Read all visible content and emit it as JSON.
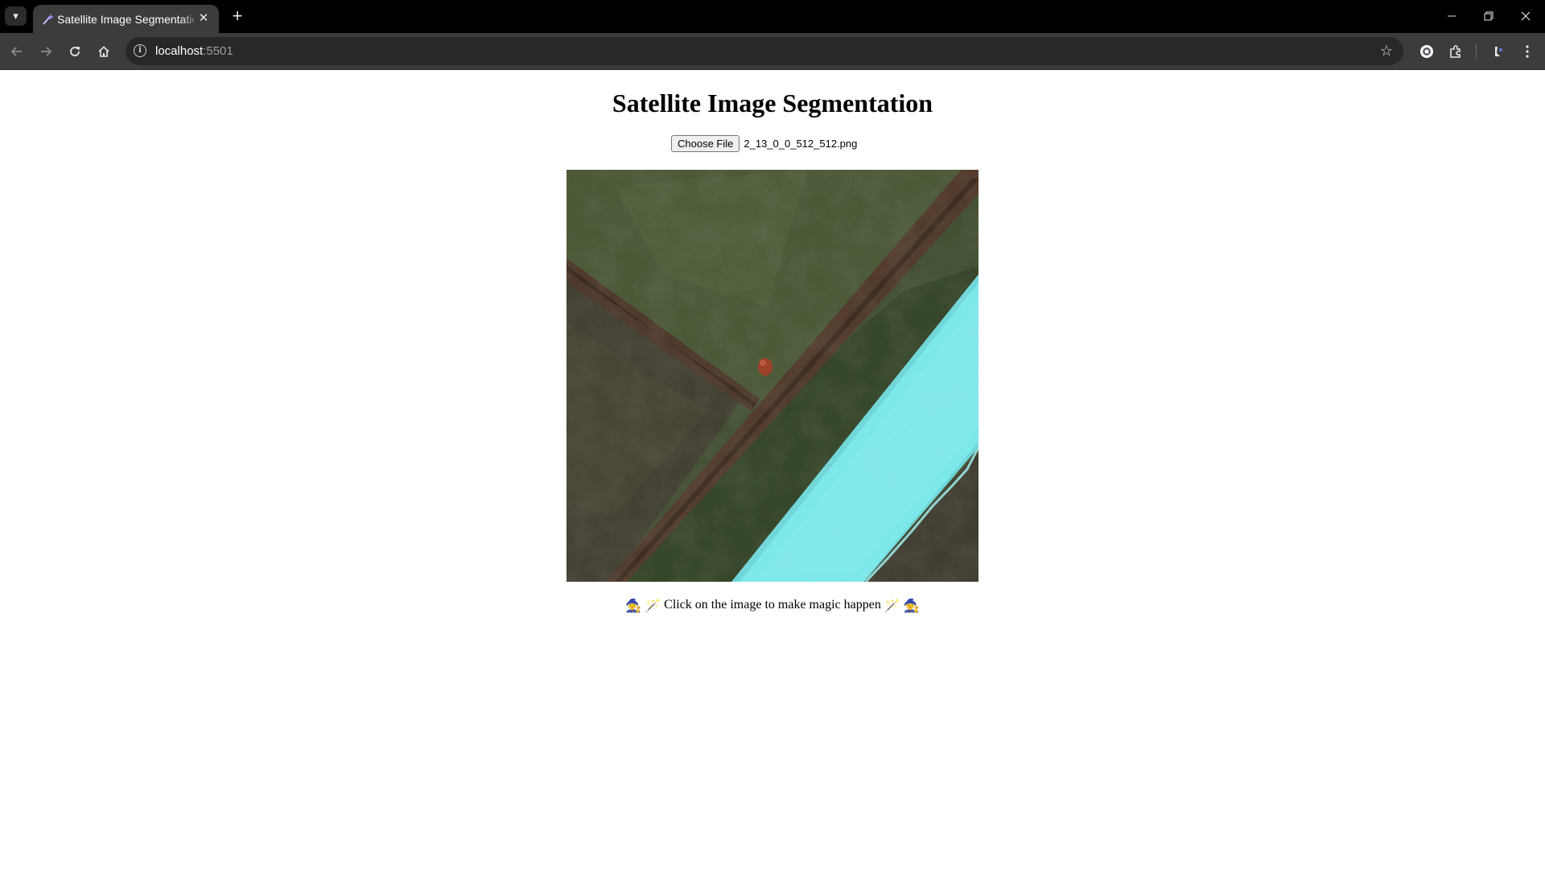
{
  "browser": {
    "tab": {
      "title": "Satellite Image Segmentation"
    },
    "address": {
      "host": "localhost",
      "port": ":5501"
    }
  },
  "page": {
    "title": "Satellite Image Segmentation",
    "file_input": {
      "button_label": "Choose File",
      "file_name": "2_13_0_0_512_512.png"
    },
    "caption": "Click on the image to make magic happen"
  },
  "colors": {
    "segmentation_mask": "#7ff5f7",
    "grass": "#4a5a3a",
    "hedge": "#5a4232",
    "chrome_dark": "#000000",
    "chrome_toolbar": "#3c3c3c"
  },
  "icons": {
    "left_emoji": [
      "mage",
      "magic-wand"
    ],
    "right_emoji": [
      "magic-wand",
      "mage"
    ]
  }
}
